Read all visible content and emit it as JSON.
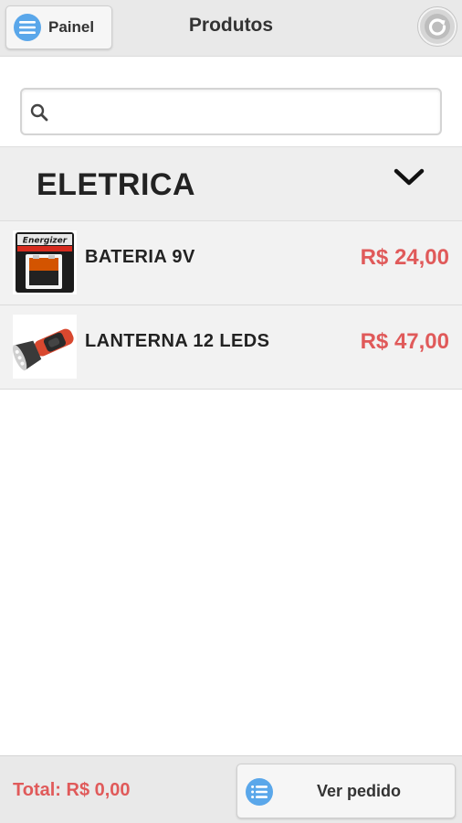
{
  "header": {
    "panel_label": "Painel",
    "title": "Produtos",
    "menu_icon": "menu-icon",
    "refresh_icon": "refresh-icon"
  },
  "search": {
    "value": "",
    "placeholder": "",
    "icon": "search-icon"
  },
  "category": {
    "label": "ELETRICA",
    "icon": "chevron-down-icon"
  },
  "products": [
    {
      "name": "BATERIA 9V",
      "price": "R$ 24,00",
      "image": "battery-image"
    },
    {
      "name": "LANTERNA 12 LEDS",
      "price": "R$ 47,00",
      "image": "flashlight-image"
    }
  ],
  "footer": {
    "total": "Total: R$ 0,00",
    "order_label": "Ver pedido",
    "order_icon": "list-icon"
  },
  "colors": {
    "accent_blue": "#5aa7ea",
    "price_red": "#e05a5a",
    "header_bg": "#e9e9e9"
  }
}
